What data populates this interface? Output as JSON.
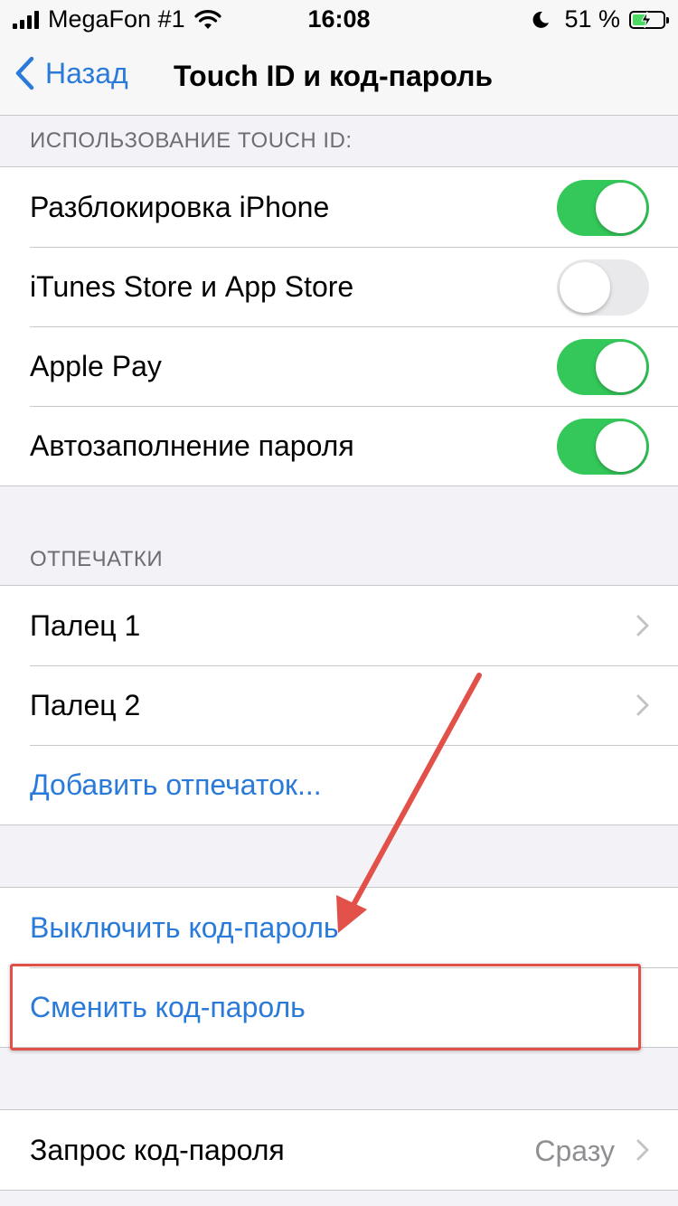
{
  "status_bar": {
    "carrier": "MegaFon #1",
    "time": "16:08",
    "battery_percent": "51 %",
    "battery_level": 0.51
  },
  "nav": {
    "back_label": "Назад",
    "title": "Touch ID и код-пароль"
  },
  "touch_id_section": {
    "header": "ИСПОЛЬЗОВАНИЕ TOUCH ID:",
    "items": [
      {
        "label": "Разблокировка iPhone",
        "enabled": true
      },
      {
        "label": "iTunes Store и App Store",
        "enabled": false
      },
      {
        "label": "Apple Pay",
        "enabled": true
      },
      {
        "label": "Автозаполнение пароля",
        "enabled": true
      }
    ]
  },
  "fingerprints_section": {
    "header": "ОТПЕЧАТКИ",
    "items": [
      {
        "label": "Палец 1"
      },
      {
        "label": "Палец 2"
      }
    ],
    "add_label": "Добавить отпечаток..."
  },
  "passcode_section": {
    "turn_off_label": "Выключить код-пароль",
    "change_label": "Сменить код-пароль"
  },
  "require_section": {
    "label": "Запрос код-пароля",
    "value": "Сразу"
  },
  "colors": {
    "accent": "#2a7ad9",
    "toggle_on": "#34c759",
    "annotation": "#e2504a"
  }
}
